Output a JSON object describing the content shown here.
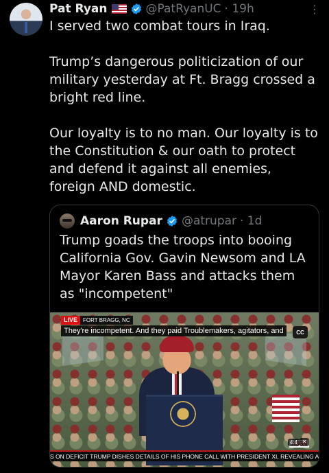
{
  "tweet": {
    "author_name": "Pat Ryan",
    "author_handle": "@PatRyanUC",
    "time": "· 19h",
    "more_icon": "more-icon",
    "text": "I served two combat tours in Iraq.\n\nTrump’s dangerous politicization of our military yesterday at Ft. Bragg crossed a bright red line.\n\nOur loyalty is to no man. Our loyalty is to the Constitution & our oath to protect and defend it against all enemies, foreign AND domestic."
  },
  "quote": {
    "author_name": "Aaron Rupar",
    "author_handle": "@atrupar",
    "time": "· 1d",
    "text": "Trump goads the troops into booing California Gov. Gavin Newsom and LA Mayor Karen Bass and attacks them as \"incompetent\"",
    "video": {
      "live_label": "LIVE",
      "location_label": "FORT BRAGG, NC",
      "caption": "They're incompetent. And they paid Troublemakers, agitators, and",
      "cc_label": "CC",
      "ticker": "S ON DEFICIT    TRUMP DISHES DETAILS OF HIS PHONE CALL WITH PRESIDENT XI, REVEALING A",
      "network": "RSBN",
      "duration": "4:4",
      "mute_icon": "mute-icon"
    }
  },
  "colors": {
    "background": "#000000",
    "text": "#e7e9ea",
    "muted": "#71767b",
    "verified": "#1d9bf0",
    "border": "#2f3336"
  }
}
